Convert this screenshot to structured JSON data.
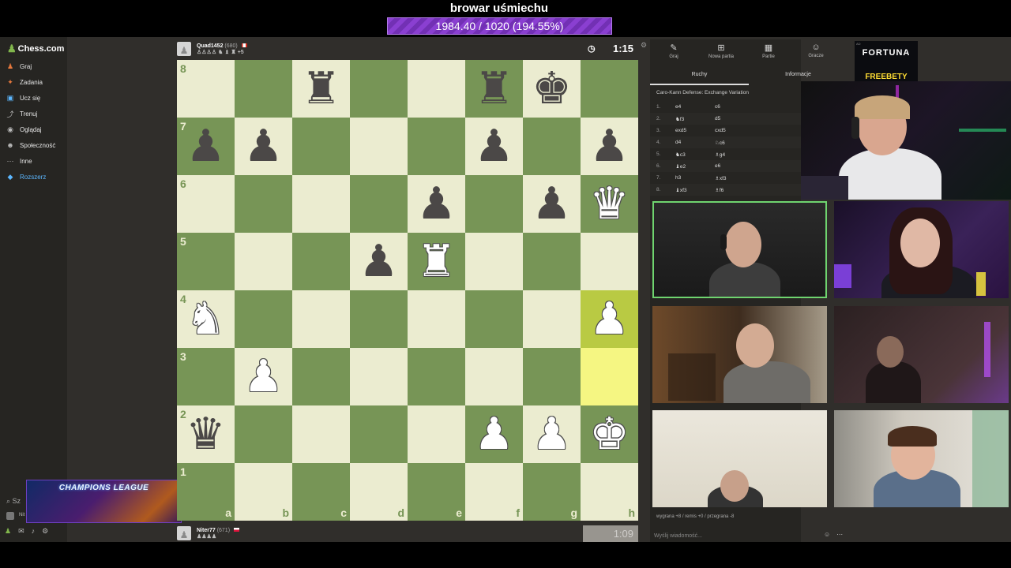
{
  "stream": {
    "title": "browar uśmiechu",
    "goal_text": "1984.40 / 1020 (194.55%)",
    "goal_percent": 194.55
  },
  "sidebar": {
    "logo": "Chess.com",
    "items": [
      {
        "label": "Graj",
        "icon": "play-icon",
        "color": "#e6783d"
      },
      {
        "label": "Zadania",
        "icon": "puzzle-icon",
        "color": "#e6783d"
      },
      {
        "label": "Ucz się",
        "icon": "learn-icon",
        "color": "#5cb7ff"
      },
      {
        "label": "Trenuj",
        "icon": "train-icon",
        "color": "#bbbbbb"
      },
      {
        "label": "Oglądaj",
        "icon": "watch-icon",
        "color": "#bbbbbb"
      },
      {
        "label": "Społeczność",
        "icon": "community-icon",
        "color": "#bbbbbb"
      },
      {
        "label": "Inne",
        "icon": "more-icon",
        "color": "#bbbbbb"
      },
      {
        "label": "Rozszerz",
        "icon": "diamond-icon",
        "color": "#5cb7ff"
      }
    ],
    "search_label": "Sz",
    "user_label": "Nit"
  },
  "overlay": {
    "label": "CHAMPIONS LEAGUE"
  },
  "top_player": {
    "name": "Quad1452",
    "rating": "(680)",
    "captured": "♙♙♙♙ ♞ ♝ ♜ +5",
    "clock": "1:15"
  },
  "bottom_player": {
    "name": "Niter77",
    "rating": "(671)",
    "captured": "♟♟♟♟",
    "clock": "1:09"
  },
  "board": {
    "files": [
      "a",
      "b",
      "c",
      "d",
      "e",
      "f",
      "g",
      "h"
    ],
    "ranks": [
      "8",
      "7",
      "6",
      "5",
      "4",
      "3",
      "2",
      "1"
    ],
    "highlight": [
      "h4",
      "h3"
    ],
    "pieces": {
      "c8": "br",
      "f8": "br",
      "g8": "bk",
      "a7": "bp",
      "b7": "bp",
      "f7": "bp",
      "h7": "bp",
      "e6": "bp",
      "g6": "bp",
      "h6": "wq",
      "d5": "bp",
      "e5": "wr",
      "a4": "wn",
      "h4": "wp",
      "b3": "wp",
      "a2": "bq",
      "f2": "wp",
      "g2": "wp",
      "h2": "wk"
    }
  },
  "right_panel": {
    "tabs": [
      {
        "label": "Graj",
        "icon": "play-icon"
      },
      {
        "label": "Nowa partia",
        "icon": "plus-icon"
      },
      {
        "label": "Partie",
        "icon": "games-icon"
      },
      {
        "label": "Gracze",
        "icon": "players-icon"
      }
    ],
    "subtabs": [
      "Ruchy",
      "Informacje"
    ],
    "opening": "Caro-Kann Defense: Exchange Variation",
    "moves": [
      {
        "n": "1.",
        "w": "e4",
        "b": "c6"
      },
      {
        "n": "2.",
        "w": "♞f3",
        "b": "d5"
      },
      {
        "n": "3.",
        "w": "exd5",
        "b": "cxd5"
      },
      {
        "n": "4.",
        "w": "d4",
        "b": "♘c6"
      },
      {
        "n": "5.",
        "w": "♞c3",
        "b": "♗g4"
      },
      {
        "n": "6.",
        "w": "♝e2",
        "b": "e6"
      },
      {
        "n": "7.",
        "w": "h3",
        "b": "♗xf3"
      },
      {
        "n": "8.",
        "w": "♝xf3",
        "b": "♗f6"
      }
    ],
    "result_line": "wygrana +8 / remis +0 / przegrana -8",
    "chat_placeholder": "Wyślij wiadomość..."
  },
  "ad": {
    "line1": "FORTUNA",
    "line2": "FREEBETY",
    "tag": "AD"
  }
}
